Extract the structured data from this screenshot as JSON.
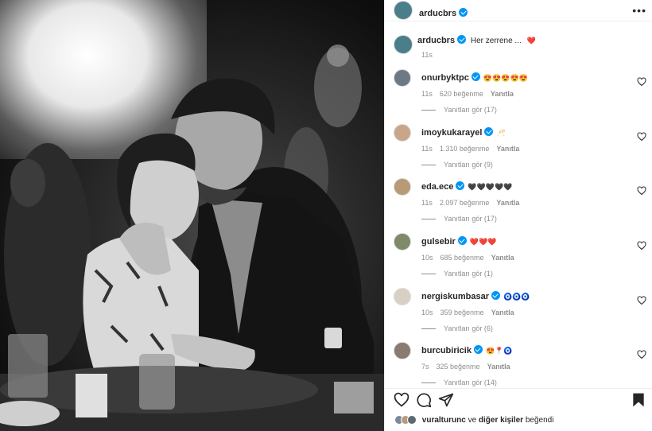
{
  "post": {
    "image_alt": "Black and white photo of a couple embracing at a dinner table",
    "author": "arducbrs",
    "caption": "Her zerrene ...",
    "caption_emoji": "❤️",
    "caption_time": "11s"
  },
  "comments": [
    {
      "user": "onurbyktpc",
      "emoji": "😍😍😍😍😍",
      "time": "11s",
      "likes": "620 beğenme",
      "reply": "Yanıtla",
      "replies": "Yanıtları gör (17)",
      "avatar_color": "#6d7a86"
    },
    {
      "user": "imoykukarayel",
      "emoji": "🥂",
      "time": "11s",
      "likes": "1.310 beğenme",
      "reply": "Yanıtla",
      "replies": "Yanıtları gör (9)",
      "avatar_color": "#c9a58a"
    },
    {
      "user": "eda.ece",
      "emoji": "🖤🖤🖤🖤🖤",
      "time": "11s",
      "likes": "2.097 beğenme",
      "reply": "Yanıtla",
      "replies": "Yanıtları gör (17)",
      "avatar_color": "#b99a77"
    },
    {
      "user": "gulsebir",
      "emoji": "❤️❤️❤️",
      "time": "10s",
      "likes": "685 beğenme",
      "reply": "Yanıtla",
      "replies": "Yanıtları gör (1)",
      "avatar_color": "#7e8a6a"
    },
    {
      "user": "nergiskumbasar",
      "emoji": "🧿🧿🧿",
      "time": "10s",
      "likes": "359 beğenme",
      "reply": "Yanıtla",
      "replies": "Yanıtları gör (6)",
      "avatar_color": "#d8d0c4"
    },
    {
      "user": "burcubiricik",
      "emoji": "😍📍🧿",
      "time": "7s",
      "likes": "325 beğenme",
      "reply": "Yanıtla",
      "replies": "Yanıtları gör (14)",
      "avatar_color": "#8a7a70"
    }
  ],
  "likes_line": {
    "user": "vuralturunc",
    "connector": "ve",
    "others": "diğer kişiler",
    "suffix": "beğendi"
  },
  "colors": {
    "verified": "#0095f6",
    "secondary_text": "#8e8e8e",
    "primary_text": "#262626"
  }
}
